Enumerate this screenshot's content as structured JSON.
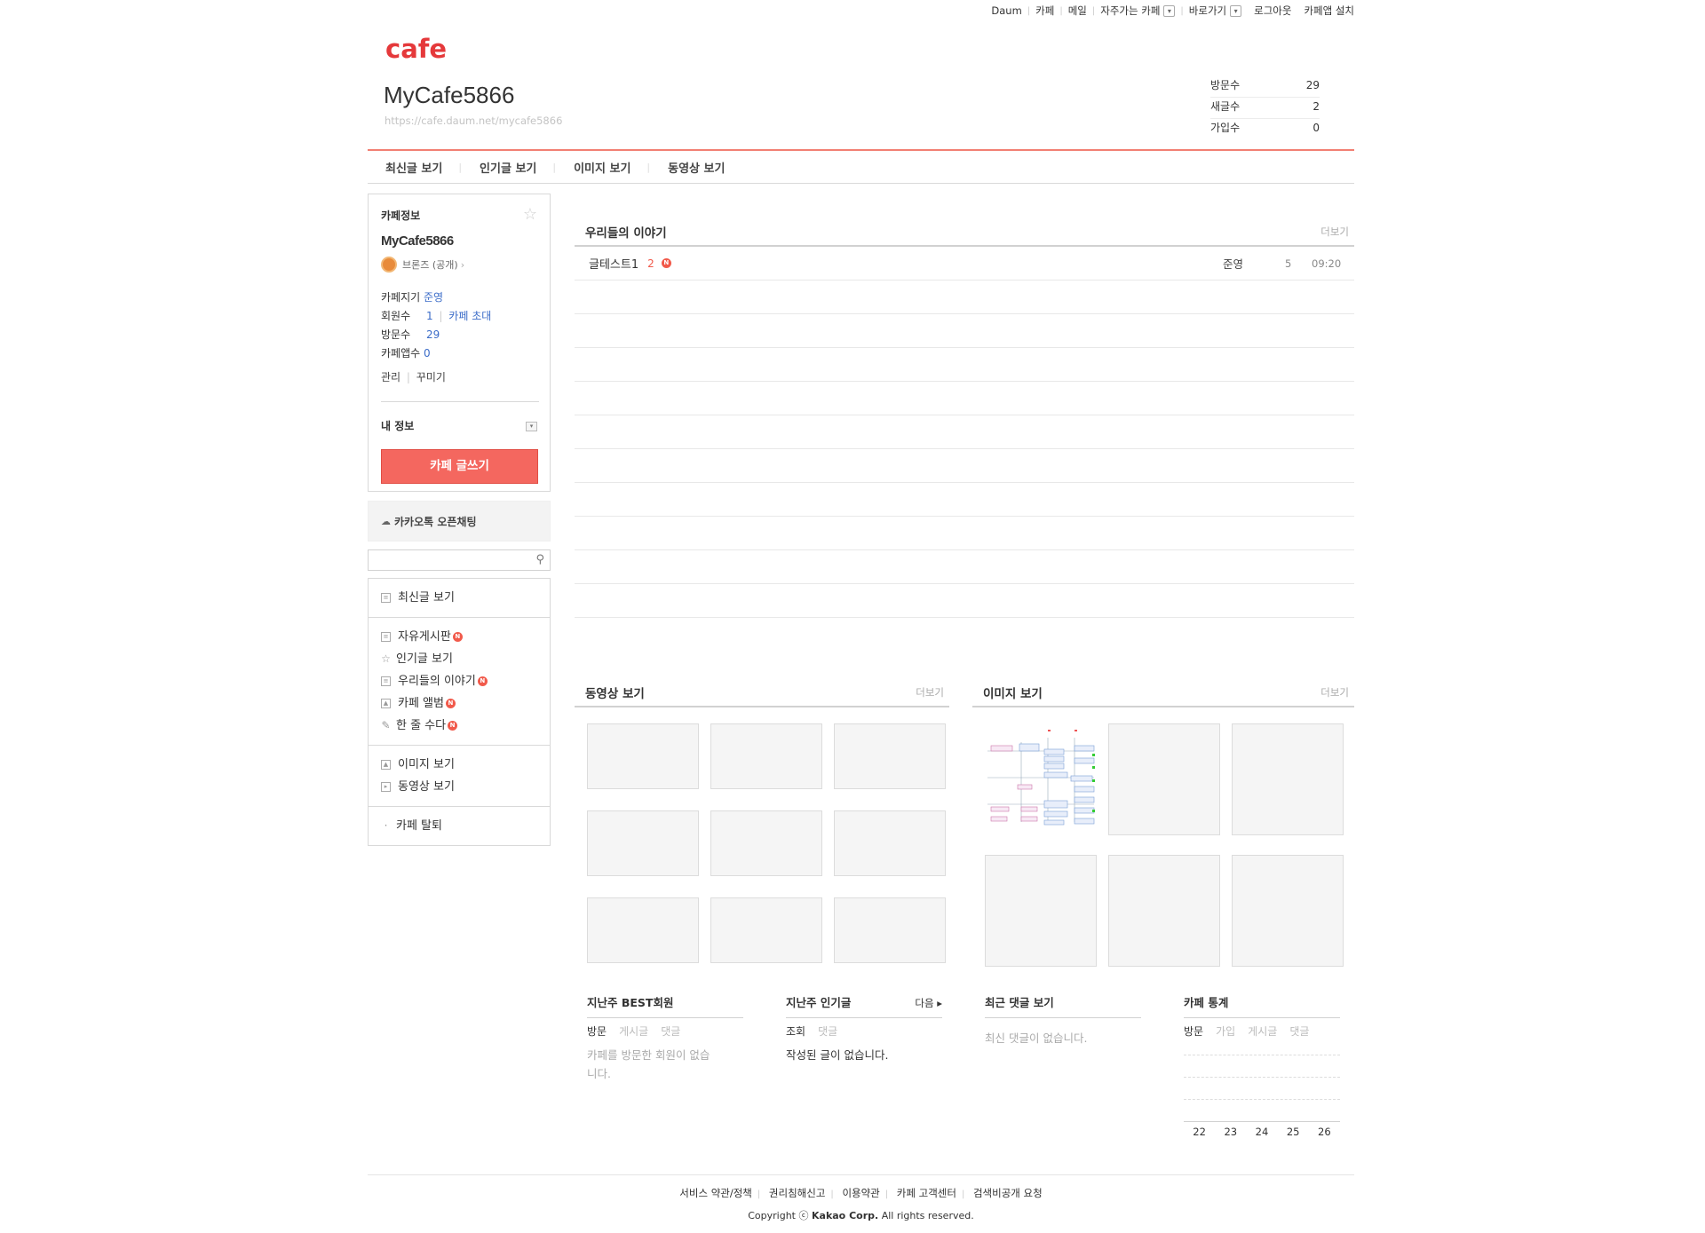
{
  "util_nav": {
    "items": [
      "Daum",
      "카페",
      "메일",
      "자주가는 카페",
      "바로가기"
    ],
    "login": "로그아웃",
    "install": "카페앱 설치"
  },
  "header": {
    "logo": "cafe",
    "cafe_name": "MyCafe5866",
    "cafe_url": "https://cafe.daum.net/mycafe5866",
    "stats": [
      {
        "label": "방문수",
        "value": "29"
      },
      {
        "label": "새글수",
        "value": "2"
      },
      {
        "label": "가입수",
        "value": "0"
      }
    ]
  },
  "main_nav": [
    "최신글 보기",
    "인기글 보기",
    "이미지 보기",
    "동영상 보기"
  ],
  "sidebar": {
    "info_title": "카페정보",
    "cafe_name": "MyCafe5866",
    "level": "브론즈 (공개)",
    "owner_label": "카페지기",
    "owner_value": "준영",
    "members_label": "회원수",
    "members_value": "1",
    "invite": "카페 초대",
    "visits_label": "방문수",
    "visits_value": "29",
    "app_label": "카페앱수",
    "app_value": "0",
    "manage": "관리",
    "decorate": "꾸미기",
    "my_info": "내 정보",
    "write_button": "카페 글쓰기",
    "kakao": "카카오톡 오픈채팅",
    "menu_groups": [
      [
        {
          "label": "최신글 보기",
          "icon": "list-icon",
          "new": false
        }
      ],
      [
        {
          "label": "자유게시판",
          "icon": "board-icon",
          "new": true
        },
        {
          "label": "인기글 보기",
          "icon": "star-icon",
          "new": false
        },
        {
          "label": "우리들의 이야기",
          "icon": "board-icon",
          "new": true
        },
        {
          "label": "카페 앨범",
          "icon": "album-icon",
          "new": true
        },
        {
          "label": "한 줄 수다",
          "icon": "pencil-icon",
          "new": true
        }
      ],
      [
        {
          "label": "이미지 보기",
          "icon": "image-icon",
          "new": false
        },
        {
          "label": "동영상 보기",
          "icon": "video-icon",
          "new": false
        }
      ],
      [
        {
          "label": "카페 탈퇴",
          "icon": "bullet-icon",
          "new": false
        }
      ]
    ],
    "new_badge": "N"
  },
  "board": {
    "title": "우리들의 이야기",
    "more": "더보기",
    "posts": [
      {
        "title": "글테스트1",
        "comments": "2",
        "writer": "준영",
        "views": "5",
        "time": "09:20"
      }
    ]
  },
  "video": {
    "title": "동영상 보기",
    "more": "더보기"
  },
  "images": {
    "title": "이미지 보기",
    "more": "더보기"
  },
  "best_members": {
    "title": "지난주 BEST회원",
    "tabs": [
      "방문",
      "게시글",
      "댓글"
    ],
    "empty": "카페를 방문한 회원이 없습니다."
  },
  "popular": {
    "title": "지난주 인기글",
    "next": "다음",
    "tabs": [
      "조회",
      "댓글"
    ],
    "empty": "작성된 글이 없습니다."
  },
  "recent_comments": {
    "title": "최근 댓글 보기",
    "empty": "최신 댓글이 없습니다."
  },
  "cafe_stats": {
    "title": "카페 통계",
    "tabs": [
      "방문",
      "가입",
      "게시글",
      "댓글"
    ],
    "days": [
      "22",
      "23",
      "24",
      "25",
      "26"
    ]
  },
  "footer": {
    "links": [
      "서비스 약관/정책",
      "권리침해신고",
      "이용약관",
      "카페 고객센터",
      "검색비공개 요청"
    ],
    "copyright_prefix": "Copyright ⓒ",
    "company": "Kakao Corp.",
    "rights": "All rights reserved."
  },
  "colors": {
    "brand": "#e5393b",
    "button": "#f4675f",
    "badge": "#f15a4b",
    "link": "#3b6cc8"
  }
}
